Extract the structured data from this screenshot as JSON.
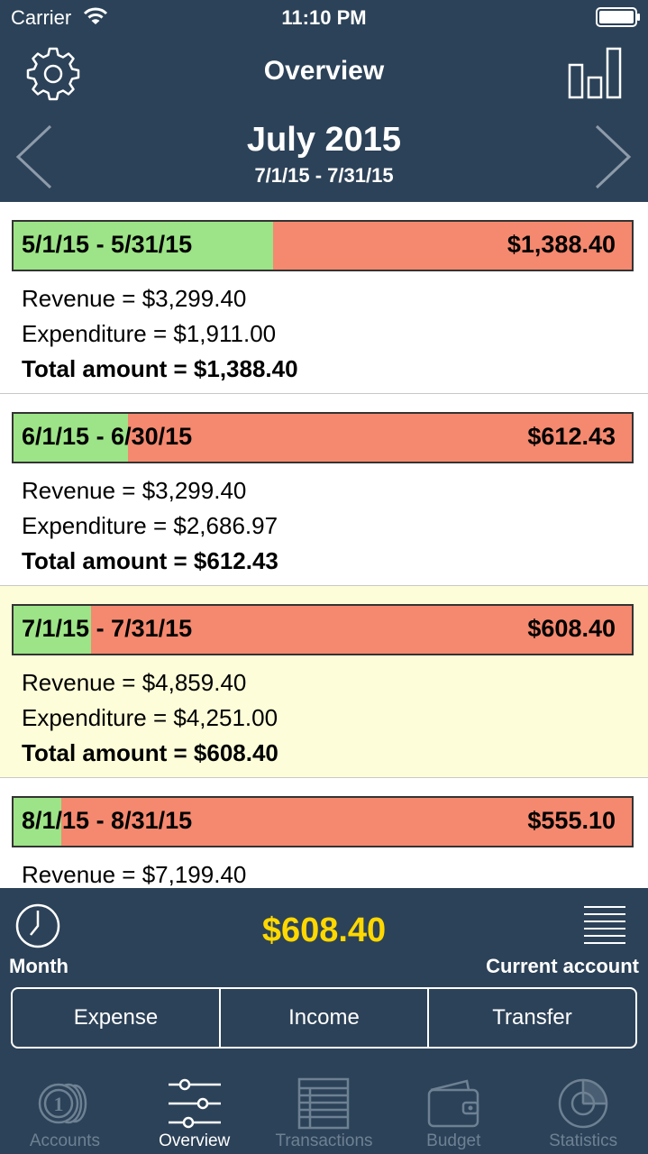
{
  "status_bar": {
    "carrier": "Carrier",
    "time": "11:10 PM"
  },
  "nav": {
    "title": "Overview"
  },
  "period_header": {
    "month": "July 2015",
    "range": "7/1/15 - 7/31/15"
  },
  "periods": [
    {
      "range": "5/1/15 - 5/31/15",
      "amount": "$1,388.40",
      "revenue": "Revenue = $3,299.40",
      "expenditure": "Expenditure = $1,911.00",
      "total": "Total amount = $1,388.40",
      "revenue_share": 0.42,
      "current": false
    },
    {
      "range": "6/1/15 - 6/30/15",
      "amount": "$612.43",
      "revenue": "Revenue = $3,299.40",
      "expenditure": "Expenditure = $2,686.97",
      "total": "Total amount = $612.43",
      "revenue_share": 0.185,
      "current": false
    },
    {
      "range": "7/1/15 - 7/31/15",
      "amount": "$608.40",
      "revenue": "Revenue = $4,859.40",
      "expenditure": "Expenditure = $4,251.00",
      "total": "Total amount = $608.40",
      "revenue_share": 0.125,
      "current": true
    },
    {
      "range": "8/1/15 - 8/31/15",
      "amount": "$555.10",
      "revenue": "Revenue = $7,199.40",
      "expenditure": "",
      "total": "",
      "revenue_share": 0.077,
      "current": false
    }
  ],
  "bottom": {
    "period_label": "Month",
    "balance": "$608.40",
    "account_label": "Current account",
    "buttons": {
      "expense": "Expense",
      "income": "Income",
      "transfer": "Transfer"
    }
  },
  "tabs": [
    {
      "label": "Accounts",
      "icon": "coins-icon"
    },
    {
      "label": "Overview",
      "icon": "sliders-icon",
      "active": true
    },
    {
      "label": "Transactions",
      "icon": "ledger-icon"
    },
    {
      "label": "Budget",
      "icon": "wallet-icon"
    },
    {
      "label": "Statistics",
      "icon": "pie-chart-icon"
    }
  ],
  "colors": {
    "header_bg": "#2c4258",
    "revenue_green": "#9de387",
    "expense_red": "#f4896f",
    "current_highlight": "#fdfdd9",
    "balance_yellow": "#ffd800"
  }
}
